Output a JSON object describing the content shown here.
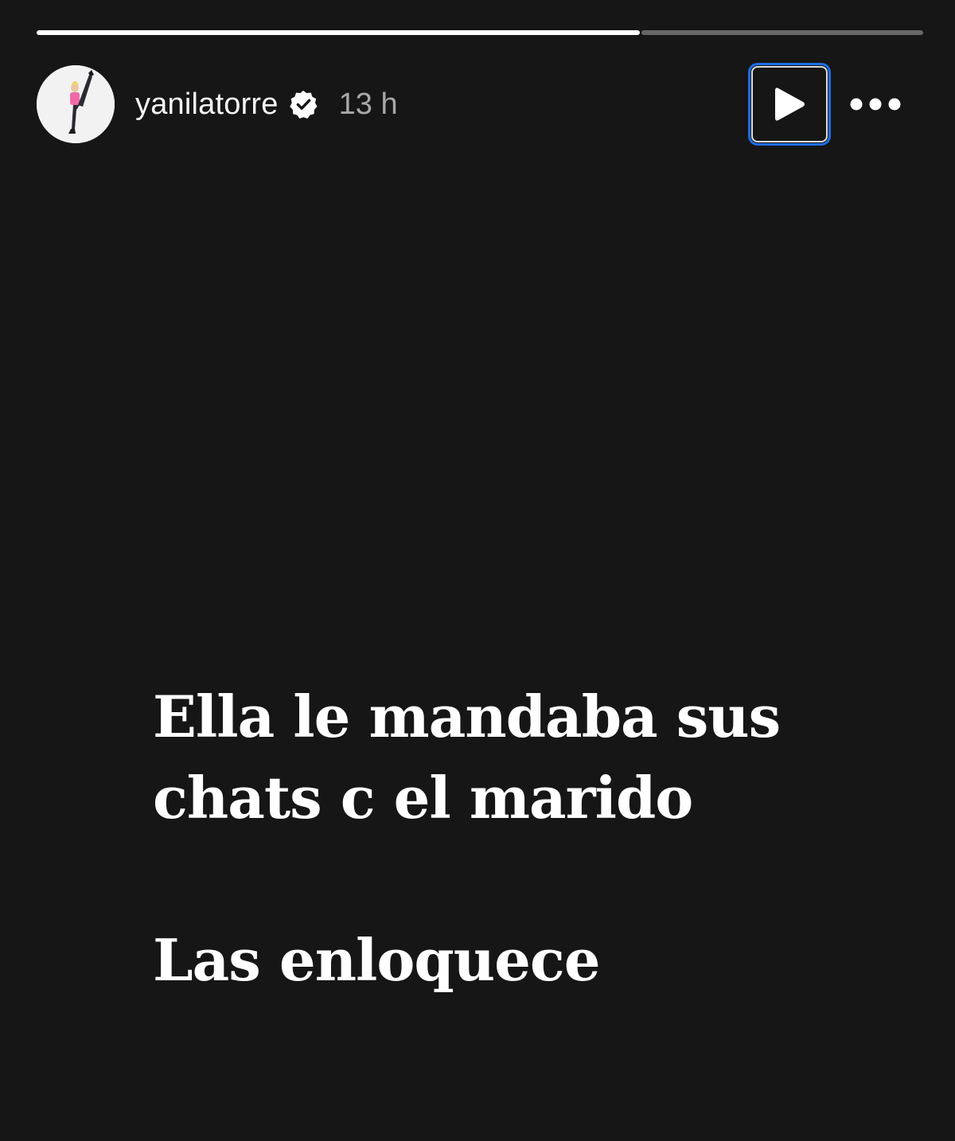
{
  "progress": {
    "segments": 2,
    "current_fill": [
      1.0,
      0.0
    ],
    "first_segment_share": 0.68
  },
  "header": {
    "avatar_icon": "profile-avatar",
    "username": "yanilatorre",
    "verified_icon": "verified-badge-icon",
    "time": "13 h",
    "play_icon": "play-icon",
    "more_icon": "more-horizontal-icon"
  },
  "story": {
    "line1": "Ella le mandaba sus",
    "line2": "chats c el marido",
    "line3": "Las enloquece"
  },
  "colors": {
    "background": "#161616",
    "text": "#ffffff",
    "time": "#a8a8a8",
    "focus_ring": "#1f6ee8"
  }
}
